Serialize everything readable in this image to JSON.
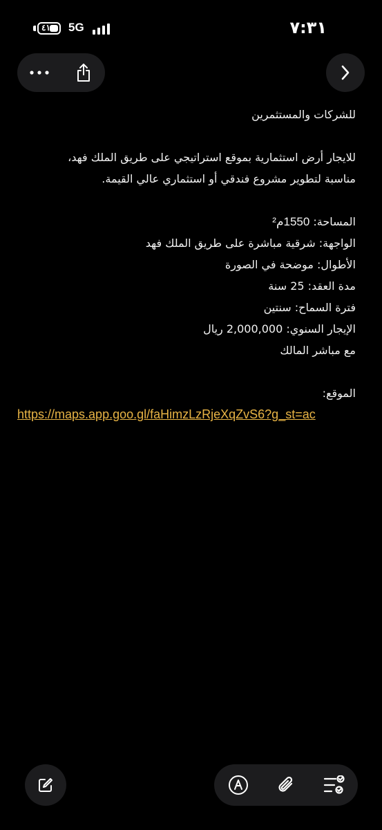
{
  "status_bar": {
    "battery": "٤١",
    "battery_level": 0.41,
    "network": "5G",
    "time": "٧:٣١"
  },
  "toolbar": {
    "more_icon": "ellipsis-icon",
    "share_icon": "share-icon",
    "forward_icon": "chevron-right-icon"
  },
  "message": {
    "heading": "للشركات والمستثمرين",
    "intro_line1": "للايجار أرض استثمارية بموقع استراتيجي على طريق الملك فهد،",
    "intro_line2": "مناسبة لتطوير مشروع فندقي أو استثماري عالي القيمة.",
    "area_label": "المساحة: ",
    "area_value": "1550م²",
    "facade": "الواجهة: شرقية مباشرة على طريق الملك فهد",
    "dimensions": "الأطوال: موضحة في الصورة",
    "contract_label": "مدة العقد: ",
    "contract_value": "25 سنة",
    "grace": "فترة السماح: سنتين",
    "rent_label": "الإيجار السنوي: ",
    "rent_value": "2,000,000 ريال",
    "owner": "مع مباشر المالك",
    "location_label": "الموقع:",
    "link": "https://maps.app.goo.gl/faHimzLzRjeXqZvS6?g_st=ac"
  },
  "bottom_toolbar": {
    "compose_icon": "compose-icon",
    "markup_icon": "markup-pen-icon",
    "attach_icon": "paperclip-icon",
    "checklist_icon": "checklist-icon"
  },
  "colors": {
    "background": "#000000",
    "button_bg": "#1c1c1e",
    "link": "#e8b445",
    "text": "#f2f2f2"
  }
}
